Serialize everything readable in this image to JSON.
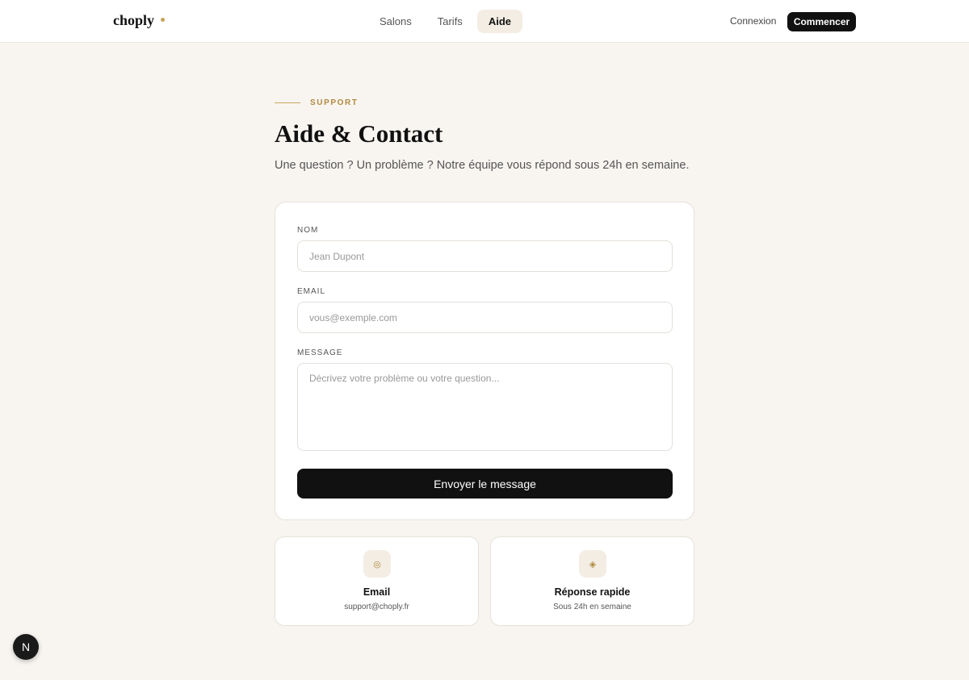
{
  "header": {
    "logo": "choply",
    "nav": [
      {
        "label": "Salons",
        "active": false
      },
      {
        "label": "Tarifs",
        "active": false
      },
      {
        "label": "Aide",
        "active": true
      }
    ],
    "login_label": "Connexion",
    "start_label": "Commencer"
  },
  "intro": {
    "eyebrow": "SUPPORT",
    "title": "Aide & Contact",
    "subtitle": "Une question ? Un problème ? Notre équipe vous répond sous 24h en semaine."
  },
  "form": {
    "name_label": "NOM",
    "name_placeholder": "Jean Dupont",
    "email_label": "EMAIL",
    "email_placeholder": "vous@exemple.com",
    "message_label": "MESSAGE",
    "message_placeholder": "Décrivez votre problème ou votre question...",
    "submit_label": "Envoyer le message"
  },
  "info": [
    {
      "icon": "email-icon",
      "title": "Email",
      "subtitle": "support@choply.fr"
    },
    {
      "icon": "quick-response-icon",
      "title": "Réponse rapide",
      "subtitle": "Sous 24h en semaine"
    }
  ],
  "badge": {
    "label": "N"
  },
  "colors": {
    "accent": "#c8a45a",
    "primary": "#111111",
    "background": "#f8f5f1"
  }
}
